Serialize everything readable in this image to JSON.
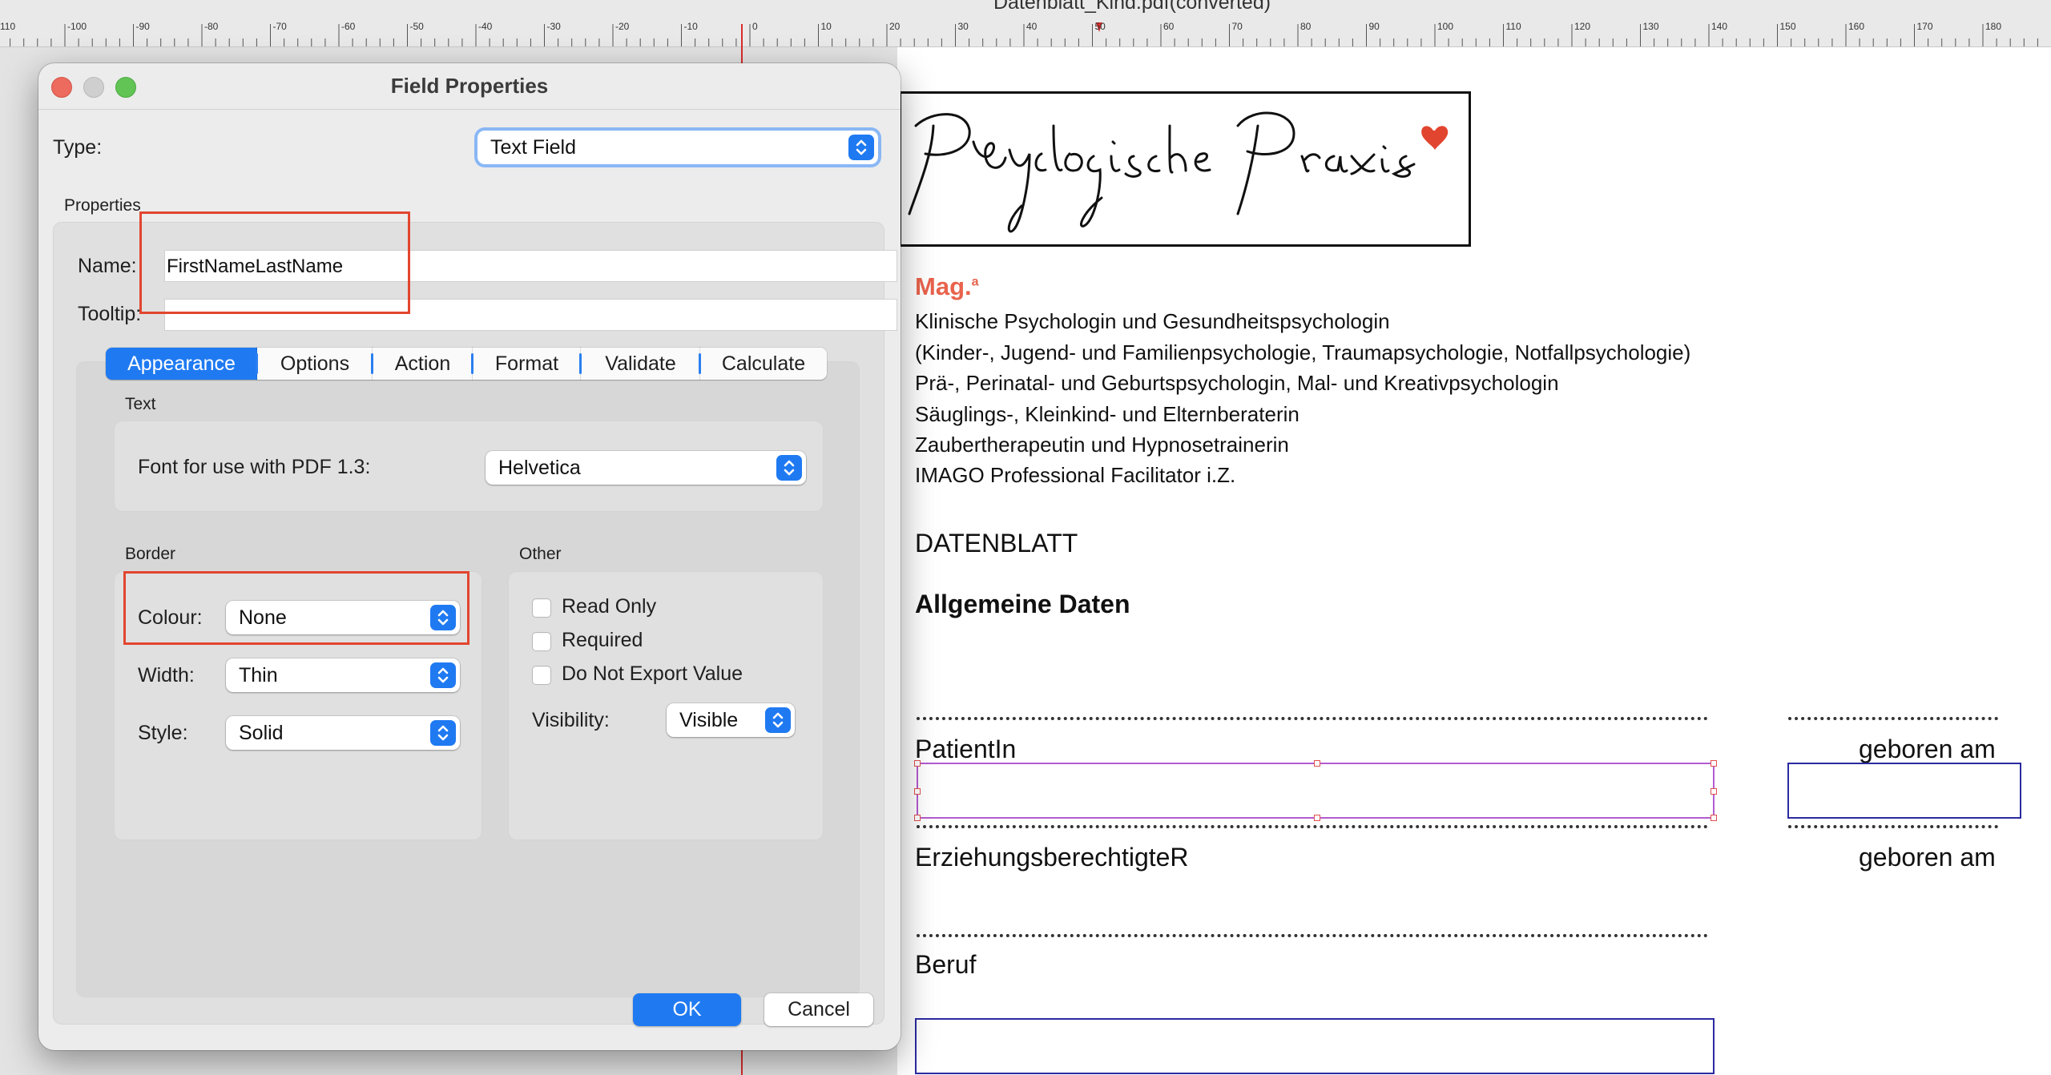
{
  "window": {
    "title": "Datenblatt_Kind.pdf(converted)"
  },
  "ruler": {
    "labels": [
      "110",
      "-100",
      "-90",
      "-80",
      "-70",
      "-60",
      "-50",
      "-40",
      "-30",
      "-20",
      "-10",
      "0",
      "10",
      "20",
      "30",
      "40",
      "50",
      "60",
      "70",
      "80",
      "90",
      "100",
      "110",
      "120",
      "130",
      "140",
      "150",
      "160",
      "170",
      "180"
    ]
  },
  "dialog": {
    "title": "Field Properties",
    "type_label": "Type:",
    "type_value": "Text Field",
    "properties_label": "Properties",
    "name_label": "Name:",
    "name_value": "FirstNameLastName",
    "tooltip_label": "Tooltip:",
    "tooltip_value": "",
    "tabs": [
      "Appearance",
      "Options",
      "Action",
      "Format",
      "Validate",
      "Calculate"
    ],
    "selected_tab": "Appearance",
    "text_section": {
      "title": "Text",
      "font_label": "Font for use with PDF 1.3:",
      "font_value": "Helvetica"
    },
    "border_section": {
      "title": "Border",
      "colour_label": "Colour:",
      "colour_value": "None",
      "width_label": "Width:",
      "width_value": "Thin",
      "style_label": "Style:",
      "style_value": "Solid"
    },
    "other_section": {
      "title": "Other",
      "read_only_label": "Read Only",
      "read_only_checked": false,
      "required_label": "Required",
      "required_checked": false,
      "do_not_export_label": "Do Not Export Value",
      "do_not_export_checked": false,
      "visibility_label": "Visibility:",
      "visibility_value": "Visible"
    },
    "ok_label": "OK",
    "cancel_label": "Cancel",
    "accent_color": "#1f7af2"
  },
  "document": {
    "logo_text": "Psychologische Praxis",
    "mag": "Mag.",
    "mag_sup": "a",
    "lines": [
      "Klinische Psychologin und Gesundheitspsychologin",
      "(Kinder-, Jugend- und Familienpsychologie, Traumapsychologie, Notfallpsychologie)",
      "Prä-, Perinatal- und Geburtspsychologin, Mal- und Kreativpsychologin",
      "Säuglings-, Kleinkind- und Elternberaterin",
      "Zaubertherapeutin und Hypnosetrainerin",
      "IMAGO Professional Facilitator i.Z."
    ],
    "heading": "DATENBLATT",
    "subheading": "Allgemeine Daten",
    "patient_label": "PatientIn",
    "born_label_1": "geboren am",
    "guardian_label": "ErziehungsberechtigteR",
    "born_label_2": "geboren am",
    "job_label": "Beruf",
    "accent_color": "#e8634c"
  }
}
